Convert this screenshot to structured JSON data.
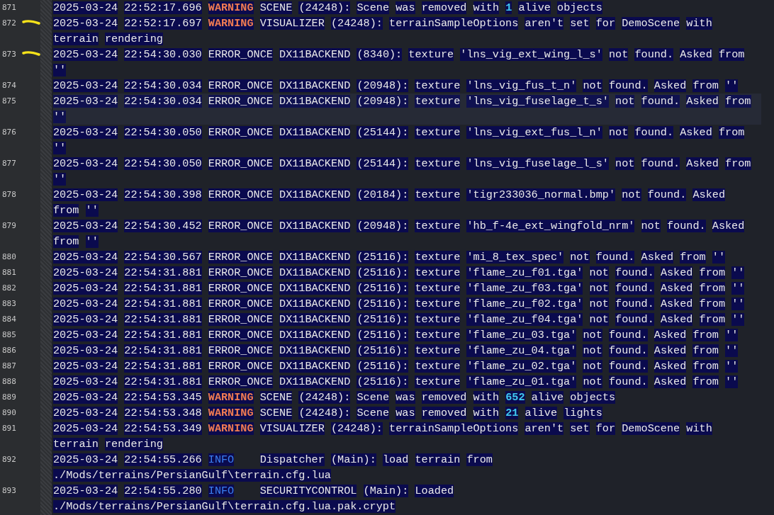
{
  "log_lines": [
    {
      "line": "871",
      "marked": false,
      "selected": false,
      "segments": [
        {
          "kind": "plain",
          "text": "2025-03-24 22:52:17.696 "
        },
        {
          "kind": "warning",
          "text": "WARNING"
        },
        {
          "kind": "plain",
          "text": " SCENE (24248): Scene was removed with "
        },
        {
          "kind": "number",
          "text": "1"
        },
        {
          "kind": "plain",
          "text": " alive objects"
        }
      ]
    },
    {
      "line": "872",
      "marked": true,
      "selected": false,
      "segments": [
        {
          "kind": "plain",
          "text": "2025-03-24 22:52:17.697 "
        },
        {
          "kind": "warning",
          "text": "WARNING"
        },
        {
          "kind": "plain",
          "text": " VISUALIZER (24248): terrainSampleOptions aren't set for DemoScene with terrain rendering"
        }
      ]
    },
    {
      "line": "873",
      "marked": true,
      "selected": false,
      "segments": [
        {
          "kind": "plain",
          "text": "2025-03-24 22:54:30.030 ERROR_ONCE DX11BACKEND (8340): texture 'lns_vig_ext_wing_l_s' not found. Asked from ''"
        }
      ]
    },
    {
      "line": "874",
      "marked": false,
      "selected": false,
      "segments": [
        {
          "kind": "plain",
          "text": "2025-03-24 22:54:30.034 ERROR_ONCE DX11BACKEND (20948): texture 'lns_vig_fus_t_n' not found. Asked from ''"
        }
      ]
    },
    {
      "line": "875",
      "marked": false,
      "selected": true,
      "segments": [
        {
          "kind": "plain",
          "text": "2025-03-24 22:54:30.034 ERROR_ONCE DX11BACKEND (20948): texture 'lns_vig_fuselage_t_s' not found. Asked from ''"
        }
      ]
    },
    {
      "line": "876",
      "marked": false,
      "selected": false,
      "segments": [
        {
          "kind": "plain",
          "text": "2025-03-24 22:54:30.050 ERROR_ONCE DX11BACKEND (25144): texture 'lns_vig_ext_fus_l_n' not found. Asked from ''"
        }
      ]
    },
    {
      "line": "877",
      "marked": false,
      "selected": false,
      "segments": [
        {
          "kind": "plain",
          "text": "2025-03-24 22:54:30.050 ERROR_ONCE DX11BACKEND (25144): texture 'lns_vig_fuselage_l_s' not found. Asked from ''"
        }
      ]
    },
    {
      "line": "878",
      "marked": false,
      "selected": false,
      "segments": [
        {
          "kind": "plain",
          "text": "2025-03-24 22:54:30.398 ERROR_ONCE DX11BACKEND (20184): texture 'tigr233036_normal.bmp' not found. Asked from ''"
        }
      ]
    },
    {
      "line": "879",
      "marked": false,
      "selected": false,
      "segments": [
        {
          "kind": "plain",
          "text": "2025-03-24 22:54:30.452 ERROR_ONCE DX11BACKEND (20948): texture 'hb_f-4e_ext_wingfold_nrm' not found. Asked from ''"
        }
      ]
    },
    {
      "line": "880",
      "marked": false,
      "selected": false,
      "segments": [
        {
          "kind": "plain",
          "text": "2025-03-24 22:54:30.567 ERROR_ONCE DX11BACKEND (25116): texture 'mi_8_tex_spec' not found. Asked from ''"
        }
      ]
    },
    {
      "line": "881",
      "marked": false,
      "selected": false,
      "segments": [
        {
          "kind": "plain",
          "text": "2025-03-24 22:54:31.881 ERROR_ONCE DX11BACKEND (25116): texture 'flame_zu_f01.tga' not found. Asked from ''"
        }
      ]
    },
    {
      "line": "882",
      "marked": false,
      "selected": false,
      "segments": [
        {
          "kind": "plain",
          "text": "2025-03-24 22:54:31.881 ERROR_ONCE DX11BACKEND (25116): texture 'flame_zu_f03.tga' not found. Asked from ''"
        }
      ]
    },
    {
      "line": "883",
      "marked": false,
      "selected": false,
      "segments": [
        {
          "kind": "plain",
          "text": "2025-03-24 22:54:31.881 ERROR_ONCE DX11BACKEND (25116): texture 'flame_zu_f02.tga' not found. Asked from ''"
        }
      ]
    },
    {
      "line": "884",
      "marked": false,
      "selected": false,
      "segments": [
        {
          "kind": "plain",
          "text": "2025-03-24 22:54:31.881 ERROR_ONCE DX11BACKEND (25116): texture 'flame_zu_f04.tga' not found. Asked from ''"
        }
      ]
    },
    {
      "line": "885",
      "marked": false,
      "selected": false,
      "segments": [
        {
          "kind": "plain",
          "text": "2025-03-24 22:54:31.881 ERROR_ONCE DX11BACKEND (25116): texture 'flame_zu_03.tga' not found. Asked from ''"
        }
      ]
    },
    {
      "line": "886",
      "marked": false,
      "selected": false,
      "segments": [
        {
          "kind": "plain",
          "text": "2025-03-24 22:54:31.881 ERROR_ONCE DX11BACKEND (25116): texture 'flame_zu_04.tga' not found. Asked from ''"
        }
      ]
    },
    {
      "line": "887",
      "marked": false,
      "selected": false,
      "segments": [
        {
          "kind": "plain",
          "text": "2025-03-24 22:54:31.881 ERROR_ONCE DX11BACKEND (25116): texture 'flame_zu_02.tga' not found. Asked from ''"
        }
      ]
    },
    {
      "line": "888",
      "marked": false,
      "selected": false,
      "segments": [
        {
          "kind": "plain",
          "text": "2025-03-24 22:54:31.881 ERROR_ONCE DX11BACKEND (25116): texture 'flame_zu_01.tga' not found. Asked from ''"
        }
      ]
    },
    {
      "line": "889",
      "marked": false,
      "selected": false,
      "segments": [
        {
          "kind": "plain",
          "text": "2025-03-24 22:54:53.345 "
        },
        {
          "kind": "warning",
          "text": "WARNING"
        },
        {
          "kind": "plain",
          "text": " SCENE (24248): Scene was removed with "
        },
        {
          "kind": "number",
          "text": "652"
        },
        {
          "kind": "plain",
          "text": " alive objects"
        }
      ]
    },
    {
      "line": "890",
      "marked": false,
      "selected": false,
      "segments": [
        {
          "kind": "plain",
          "text": "2025-03-24 22:54:53.348 "
        },
        {
          "kind": "warning",
          "text": "WARNING"
        },
        {
          "kind": "plain",
          "text": " SCENE (24248): Scene was removed with "
        },
        {
          "kind": "number",
          "text": "21"
        },
        {
          "kind": "plain",
          "text": " alive lights"
        }
      ]
    },
    {
      "line": "891",
      "marked": false,
      "selected": false,
      "segments": [
        {
          "kind": "plain",
          "text": "2025-03-24 22:54:53.349 "
        },
        {
          "kind": "warning",
          "text": "WARNING"
        },
        {
          "kind": "plain",
          "text": " VISUALIZER (24248): terrainSampleOptions aren't set for DemoScene with terrain rendering"
        }
      ]
    },
    {
      "line": "892",
      "marked": false,
      "selected": false,
      "segments": [
        {
          "kind": "plain",
          "text": "2025-03-24 22:54:55.266 "
        },
        {
          "kind": "info",
          "text": "INFO"
        },
        {
          "kind": "plain",
          "text": "    Dispatcher (Main): load terrain from ./Mods/terrains/PersianGulf\\terrain.cfg.lua"
        }
      ]
    },
    {
      "line": "893",
      "marked": false,
      "selected": false,
      "segments": [
        {
          "kind": "plain",
          "text": "2025-03-24 22:54:55.280 "
        },
        {
          "kind": "info",
          "text": "INFO"
        },
        {
          "kind": "plain",
          "text": "    SECURITYCONTROL (Main): Loaded ./Mods/terrains/PersianGulf\\terrain.cfg.lua.pak.crypt"
        }
      ]
    }
  ]
}
